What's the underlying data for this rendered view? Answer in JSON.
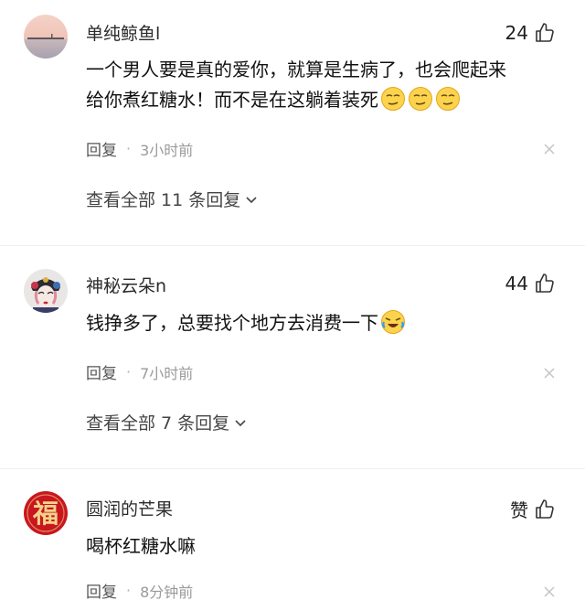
{
  "comments": [
    {
      "username": "单纯鲸鱼l",
      "likes": "24",
      "text": "一个男人要是真的爱你，就算是生病了，也会爬起来给你煮红糖水！而不是在这躺着装死",
      "emoji": [
        "smirk-emoji",
        "smirk-emoji",
        "smirk-emoji"
      ],
      "reply_label": "回复",
      "time": "3小时前",
      "view_replies": "查看全部 11 条回复"
    },
    {
      "username": "神秘云朵n",
      "likes": "44",
      "text": "钱挣多了，总要找个地方去消费一下",
      "emoji": [
        "laughing-crying-emoji"
      ],
      "reply_label": "回复",
      "time": "7小时前",
      "view_replies": "查看全部 7 条回复"
    },
    {
      "username": "圆润的芒果",
      "likes": "赞",
      "text": "喝杯红糖水嘛",
      "reply_label": "回复",
      "time": "8分钟前"
    }
  ],
  "avatar_fu_char": "福",
  "colors": {
    "text_primary": "#222222",
    "text_secondary": "#9a9a9a",
    "avatar_red": "#c8171e",
    "avatar_gold": "#f2d28a"
  },
  "icons": {
    "like": "thumbs-up-icon",
    "close": "close-icon",
    "expand": "chevron-down-icon"
  }
}
